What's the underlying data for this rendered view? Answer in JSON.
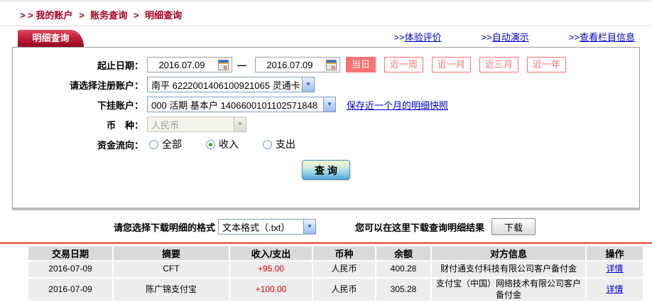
{
  "breadcrumb": {
    "prefix": "> >",
    "separator": ">",
    "items": [
      "我的账户",
      "账务查询",
      "明细查询"
    ]
  },
  "tab_label": "明细查询",
  "top_links": [
    {
      "prefix": ">>",
      "label": "体验评价"
    },
    {
      "prefix": ">>",
      "label": "自动演示"
    },
    {
      "prefix": ">>",
      "label": "查看栏目信息"
    }
  ],
  "form": {
    "date_range": {
      "label": "起止日期：",
      "start": "2016.07.09",
      "end": "2016.07.09",
      "separator": "—"
    },
    "quick_ranges": [
      {
        "label": "当日",
        "active": true
      },
      {
        "label": "近一周",
        "active": false
      },
      {
        "label": "近一月",
        "active": false
      },
      {
        "label": "近三月",
        "active": false
      },
      {
        "label": "近一年",
        "active": false
      }
    ],
    "register_account": {
      "label": "请选择注册账户：",
      "value": "南平 6222001406100921065 灵通卡"
    },
    "sub_account": {
      "label": "下挂账户：",
      "value": "000 活期 基本户 1406600101102571848",
      "snapshot_link": "保存近一个月的明细快照"
    },
    "currency": {
      "label": "币　种：",
      "value": "人民币",
      "disabled": true
    },
    "fund_flow": {
      "label": "资金流向：",
      "options": [
        {
          "label": "全部",
          "selected": false
        },
        {
          "label": "收入",
          "selected": true
        },
        {
          "label": "支出",
          "selected": false
        }
      ]
    },
    "query_button_label": "查 询"
  },
  "download": {
    "format_label": "请您选择下载明细的格式",
    "format_value": "文本格式（.txt）",
    "hint": "您可以在这里下载查询明细结果",
    "button_label": "下载"
  },
  "table": {
    "headers": [
      "交易日期",
      "摘要",
      "收入/支出",
      "币种",
      "余额",
      "对方信息",
      "操作"
    ],
    "rows": [
      {
        "date": "2016-07-09",
        "summary": "CFT",
        "amount": "+95.00",
        "currency": "人民币",
        "balance": "400.28",
        "counterparty": "财付通支付科技有限公司客户备付金",
        "action": "详情"
      },
      {
        "date": "2016-07-09",
        "summary": "陈广锦支付宝",
        "amount": "+100.00",
        "currency": "人民币",
        "balance": "305.28",
        "counterparty": "支付宝（中国）网络技术有限公司客户备付金",
        "action": "详情"
      }
    ]
  },
  "icons": {
    "dropdown_arrow": "▼",
    "calendar": "calendar-icon"
  },
  "colors": {
    "brand_red": "#a50022",
    "tab_red": "#c11f3a",
    "link_blue": "#0000cc",
    "quick_button_red": "#f87272",
    "amount_red": "#cc0000",
    "divider_red": "#e8402c"
  }
}
